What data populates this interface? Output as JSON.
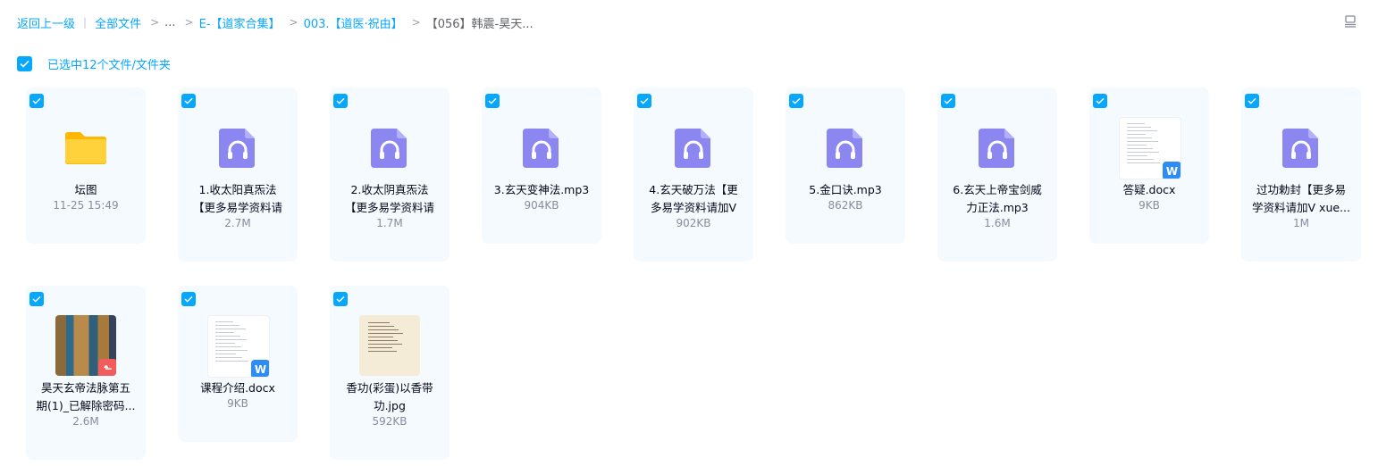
{
  "breadcrumb": {
    "back": "返回上一级",
    "all_files": "全部文件",
    "ellipsis": "...",
    "level1": "E-【道家合集】",
    "level2": "003.【道医·祝由】",
    "current": "【056】韩震-昊天..."
  },
  "selection": {
    "text": "已选中12个文件/文件夹"
  },
  "files": [
    {
      "name1": "坛图",
      "name2": "",
      "meta": "11-25 15:49",
      "type": "folder"
    },
    {
      "name1": "1.收太阳真炁法",
      "name2": "【更多易学资料请",
      "meta": "2.7M",
      "type": "audio"
    },
    {
      "name1": "2.收太阴真炁法",
      "name2": "【更多易学资料请",
      "meta": "1.7M",
      "type": "audio"
    },
    {
      "name1": "3.玄天变神法.mp3",
      "name2": "",
      "meta": "904KB",
      "type": "audio"
    },
    {
      "name1": "4.玄天破万法【更",
      "name2": "多易学资料请加V",
      "meta": "902KB",
      "type": "audio"
    },
    {
      "name1": "5.金口诀.mp3",
      "name2": "",
      "meta": "862KB",
      "type": "audio"
    },
    {
      "name1": "6.玄天上帝宝剑威",
      "name2": "力正法.mp3",
      "meta": "1.6M",
      "type": "audio"
    },
    {
      "name1": "答疑.docx",
      "name2": "",
      "meta": "9KB",
      "type": "docx"
    },
    {
      "name1": "过功勅封【更多易",
      "name2": "学资料请加V xue...",
      "meta": "1M",
      "type": "audio"
    },
    {
      "name1": "昊天玄帝法脉第五",
      "name2": "期(1)_已解除密码...",
      "meta": "2.6M",
      "type": "pdf"
    },
    {
      "name1": "课程介绍.docx",
      "name2": "",
      "meta": "9KB",
      "type": "docx"
    },
    {
      "name1": "香功(彩蛋)以香带",
      "name2": "功.jpg",
      "meta": "592KB",
      "type": "jpg"
    }
  ],
  "colors": {
    "accent": "#06a7ff",
    "card_bg": "#f4fafe",
    "audio_icon": "#8b86f0",
    "folder": "#ffc31f"
  }
}
